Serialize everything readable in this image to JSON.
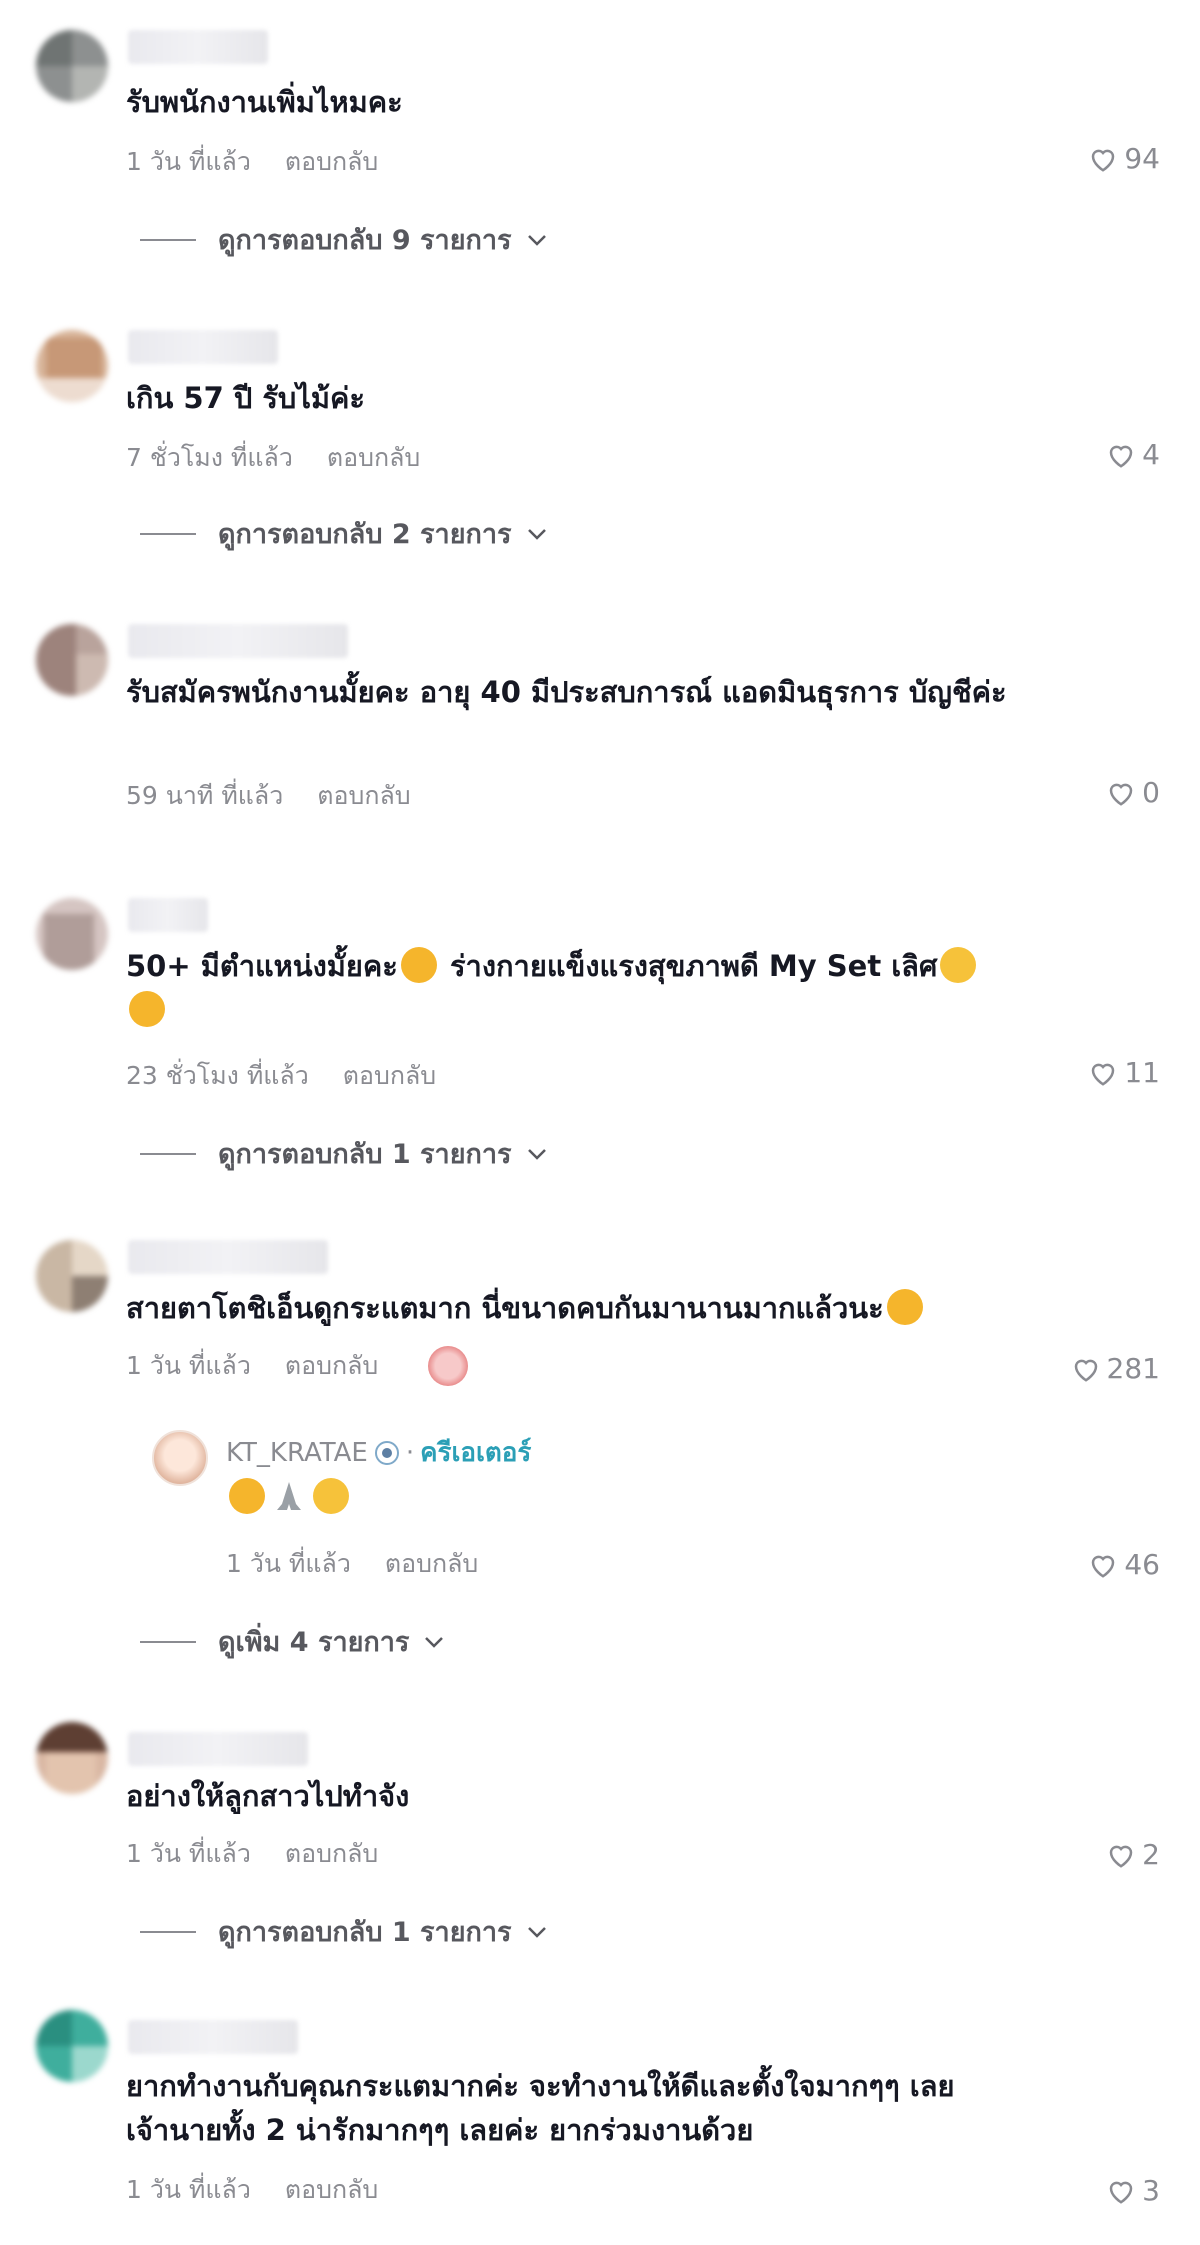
{
  "comments": [
    {
      "text": "รับพนักงานเพิ่มไหมคะ",
      "time": "1 วัน ที่แล้ว",
      "reply": "ตอบกลับ",
      "likes": "94",
      "view_replies": "ดูการตอบกลับ 9 รายการ"
    },
    {
      "text": "เกิน 57 ปี รับไม้ค่ะ",
      "time": "7 ชั่วโมง ที่แล้ว",
      "reply": "ตอบกลับ",
      "likes": "4",
      "view_replies": "ดูการตอบกลับ 2 รายการ"
    },
    {
      "text": "รับสมัครพนักงานมั้ยคะ อายุ 40 มีประสบการณ์ แอดมินธุรการ บัญชีค่ะ",
      "time": "59 นาที ที่แล้ว",
      "reply": "ตอบกลับ",
      "likes": "0"
    },
    {
      "text_part1": "50+ มีตำแหน่งมั้ยคะ",
      "text_part2": " ร่างกายแข็งแรงสุขภาพดี My Set เลิศ",
      "time": "23 ชั่วโมง ที่แล้ว",
      "reply": "ตอบกลับ",
      "likes": "11",
      "view_replies": "ดูการตอบกลับ 1 รายการ"
    },
    {
      "text": "สายตาโตชิเอ็นดูกระแตมาก นี่ขนาดคบกันมานานมากแล้วนะ",
      "time": "1 วัน ที่แล้ว",
      "reply": "ตอบกลับ",
      "likes": "281",
      "creator_reply": {
        "name": "KT_KRATAE",
        "separator": "·",
        "badge": "ครีเอเตอร์",
        "time": "1 วัน ที่แล้ว",
        "reply": "ตอบกลับ",
        "likes": "46"
      },
      "view_more": "ดูเพิ่ม 4 รายการ"
    },
    {
      "text": "อย่างให้ลูกสาวไปทำจัง",
      "time": "1 วัน ที่แล้ว",
      "reply": "ตอบกลับ",
      "likes": "2",
      "view_replies": "ดูการตอบกลับ 1 รายการ"
    },
    {
      "text_line1": "ยากทำงานกับคุณกระแตมากค่ะ จะทำงานให้ดีและตั้งใจมากๆๆ เลย",
      "text_line2": "เจ้านายทั้ง 2 น่ารักมากๆๆ เลยค่ะ ยากร่วมงานด้วย",
      "time": "1 วัน ที่แล้ว",
      "reply": "ตอบกลับ",
      "likes": "3"
    }
  ],
  "icons": {
    "like": "heart-outline-icon",
    "chevron": "chevron-down-icon",
    "verified": "verified-badge-icon"
  },
  "colors": {
    "text": "#161823",
    "muted": "#8a8b91",
    "creator": "#2b9fb6"
  }
}
